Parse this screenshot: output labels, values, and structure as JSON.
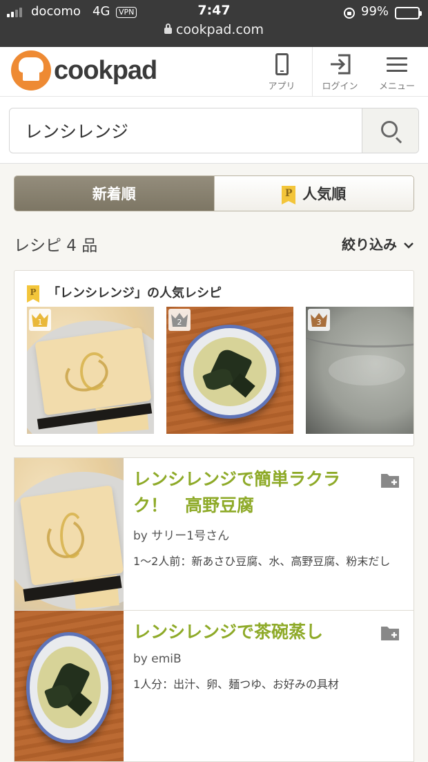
{
  "status_bar": {
    "carrier": "docomo",
    "network": "4G",
    "vpn": "VPN",
    "time": "7:47",
    "battery": "99%",
    "battery_level": 0.99,
    "url": "cookpad.com"
  },
  "header": {
    "logo": "cookpad",
    "nav": [
      {
        "label": "アプリ",
        "icon": "smartphone-icon"
      },
      {
        "label": "ログイン",
        "icon": "login-icon"
      },
      {
        "label": "メニュー",
        "icon": "hamburger-menu-icon"
      }
    ]
  },
  "search": {
    "value": "レンシレンジ",
    "button_icon": "search-icon"
  },
  "tabs": [
    {
      "label": "新着順",
      "active": true
    },
    {
      "label": "人気順",
      "active": false,
      "badge": "P"
    }
  ],
  "result_count": "レシピ 4 品",
  "filter_label": "絞り込み",
  "popular": {
    "badge": "P",
    "title": "「レンシレンジ」の人気レシピ",
    "items": [
      {
        "rank": "1",
        "image": "koya-tofu-photo",
        "crown_color": "#e9b83a"
      },
      {
        "rank": "2",
        "image": "chawanmushi-photo",
        "crown_color": "#8f8f8f"
      },
      {
        "rank": "3",
        "image": "gray-liquid-photo",
        "crown_color": "#a86f3c"
      }
    ]
  },
  "recipes": [
    {
      "title": "レンシレンジで簡単ラクラク！　高野豆腐",
      "author": "by サリー1号さん",
      "ingredients": "1〜2人前：新あさひ豆腐、水、高野豆腐、粉末だし",
      "image": "koya-tofu-photo"
    },
    {
      "title": "レンシレンジで茶碗蒸し",
      "author": "by emiB",
      "ingredients": "1人分：出汁、卵、麺つゆ、お好みの具材",
      "image": "chawanmushi-photo"
    }
  ],
  "colors": {
    "brand_orange": "#ee8a33",
    "recipe_title_green": "#8eaa28",
    "tab_active": "#8a8371",
    "status_bar_bg": "#3a3a3a"
  }
}
